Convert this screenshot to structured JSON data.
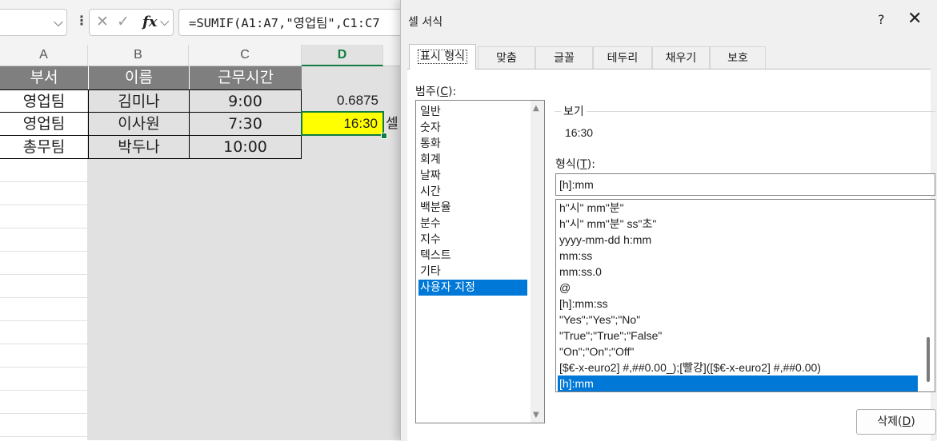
{
  "formula_bar": {
    "formula": "=SUMIF(A1:A7,\"영업팀\",C1:C7",
    "fx_label": "fx",
    "cancel_glyph": "✕",
    "enter_glyph": "✓"
  },
  "columns": [
    "A",
    "B",
    "C",
    "D"
  ],
  "table": {
    "headers": [
      "부서",
      "이름",
      "근무시간"
    ],
    "rows": [
      [
        "영업팀",
        "김미나",
        "9:00"
      ],
      [
        "영업팀",
        "이사원",
        "7:30"
      ],
      [
        "총무팀",
        "박두나",
        "10:00"
      ]
    ]
  },
  "cells": {
    "d2": "0.6875",
    "d3": "16:30",
    "e3_partial": "셀"
  },
  "dialog": {
    "title": "셀 서식",
    "help": "?",
    "close": "✕",
    "tabs": [
      "표시 형식",
      "맞춤",
      "글꼴",
      "테두리",
      "채우기",
      "보호"
    ],
    "category_label": "범주(",
    "category_key": "C",
    "category_label_end": "):",
    "categories": [
      "일반",
      "숫자",
      "통화",
      "회계",
      "날짜",
      "시간",
      "백분율",
      "분수",
      "지수",
      "텍스트",
      "기타",
      "사용자 지정"
    ],
    "selected_category": "사용자 지정",
    "sample_label": "보기",
    "sample_value": "16:30",
    "type_label": "형식(",
    "type_key": "T",
    "type_label_end": "):",
    "type_value": "[h]:mm",
    "formats": [
      "h\"시\" mm\"분\"",
      "h\"시\" mm\"분\" ss\"초\"",
      "yyyy-mm-dd h:mm",
      "mm:ss",
      "mm:ss.0",
      "@",
      "[h]:mm:ss",
      "\"Yes\";\"Yes\";\"No\"",
      "\"True\";\"True\";\"False\"",
      "\"On\";\"On\";\"Off\"",
      "[$€-x-euro2] #,##0.00_);[빨강]([$€-x-euro2] #,##0.00)",
      "[h]:mm"
    ],
    "selected_format": "[h]:mm",
    "delete_label": "삭제(",
    "delete_key": "D",
    "delete_label_end": ")"
  },
  "colors": {
    "header_fill": "#7f7f7f",
    "highlight_fill": "#ffff00",
    "selection_green": "#107c41",
    "list_selection": "#0078d7"
  }
}
